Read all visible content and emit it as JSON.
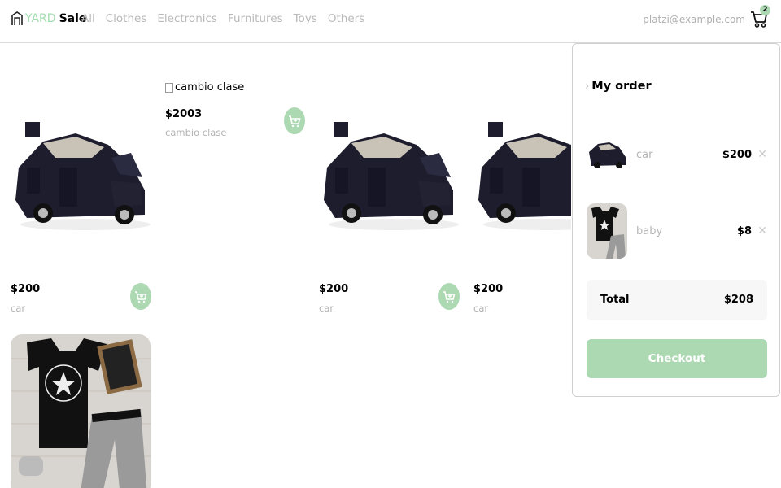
{
  "nav": {
    "logo_yard": "YARD",
    "logo_sale": "Sale",
    "menu": [
      "All",
      "Clothes",
      "Electronics",
      "Furnitures",
      "Toys",
      "Others"
    ],
    "email": "platzi@example.com",
    "cart_count": "2"
  },
  "products": [
    {
      "price": "$200",
      "name": "car",
      "image": "car"
    },
    {
      "price": "$2003",
      "name": "cambio clase",
      "image_alt": "cambio clase"
    },
    {
      "price": "$200",
      "name": "car",
      "image": "car"
    },
    {
      "price": "$200",
      "name": "car",
      "image": "car"
    },
    {
      "image": "baby"
    }
  ],
  "order": {
    "title": "My order",
    "items": [
      {
        "name": "car",
        "price": "$200",
        "remove": "✕"
      },
      {
        "name": "baby",
        "price": "$8",
        "remove": "✕"
      }
    ],
    "total_label": "Total",
    "total_value": "$208",
    "checkout_label": "Checkout"
  },
  "colors": {
    "accent": "#acd9b2",
    "muted": "#b3b3b3"
  }
}
